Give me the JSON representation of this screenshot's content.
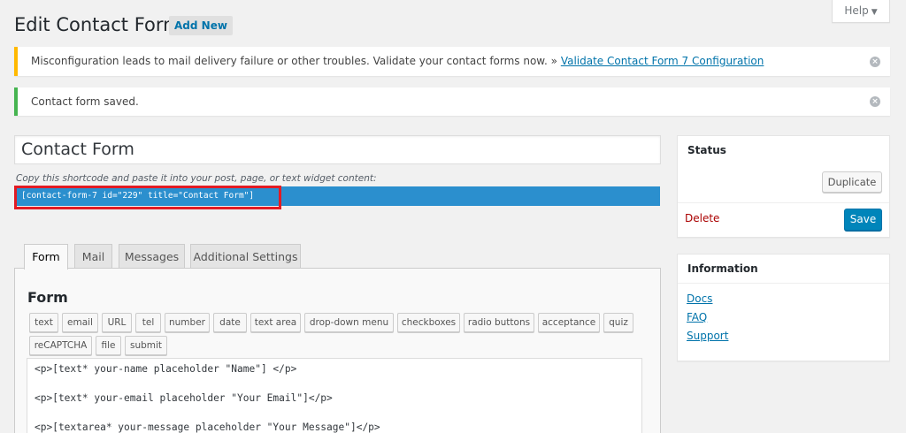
{
  "header": {
    "title": "Edit Contact Form",
    "add_new": "Add New",
    "help": "Help"
  },
  "notices": {
    "warning_text": "Misconfiguration leads to mail delivery failure or other troubles. Validate your contact forms now. » ",
    "warning_link": "Validate Contact Form 7 Configuration",
    "success_text": "Contact form saved."
  },
  "form_title": "Contact Form",
  "shortcode": {
    "hint": "Copy this shortcode and paste it into your post, page, or text widget content:",
    "code": "[contact-form-7 id=\"229\" title=\"Contact Form\"]"
  },
  "tabs": [
    "Form",
    "Mail",
    "Messages",
    "Additional Settings"
  ],
  "form_panel": {
    "heading": "Form",
    "tag_buttons": [
      "text",
      "email",
      "URL",
      "tel",
      "number",
      "date",
      "text area",
      "drop-down menu",
      "checkboxes",
      "radio buttons",
      "acceptance",
      "quiz",
      "reCAPTCHA",
      "file",
      "submit"
    ],
    "code_lines": [
      "<p>[text* your-name placeholder \"Name\"] </p>",
      "<p>[text* your-email placeholder \"Your Email\"]</p>",
      "<p>[textarea* your-message placeholder \"Your Message\"]</p>"
    ]
  },
  "status_box": {
    "title": "Status",
    "duplicate": "Duplicate",
    "delete": "Delete",
    "save": "Save"
  },
  "info_box": {
    "title": "Information",
    "links": [
      "Docs",
      "FAQ",
      "Support"
    ]
  }
}
